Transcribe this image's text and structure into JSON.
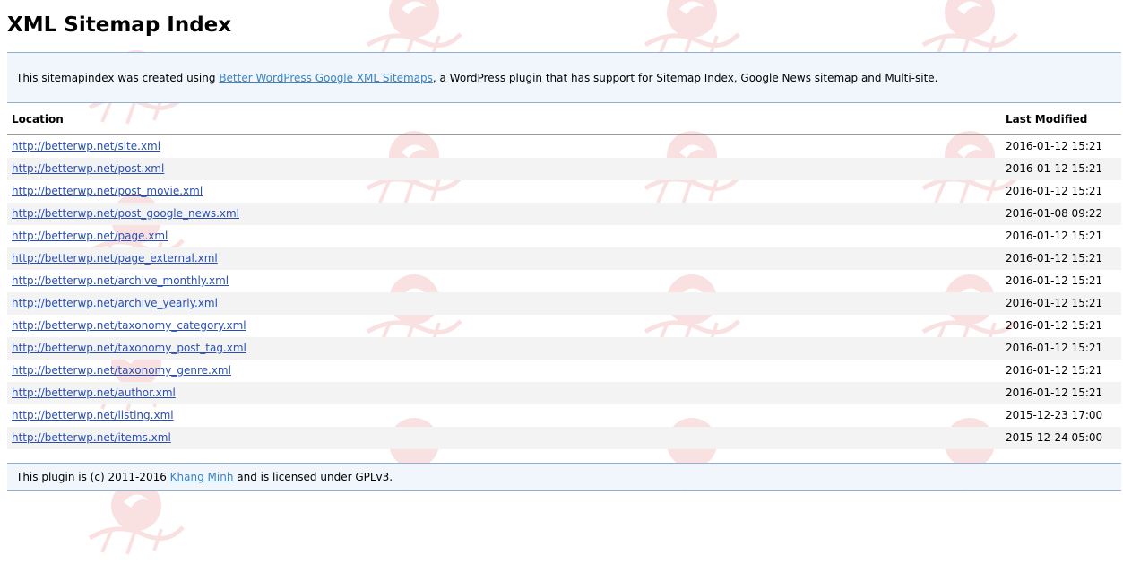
{
  "page": {
    "title": "XML Sitemap Index"
  },
  "intro": {
    "prefix": "This sitemapindex was created using ",
    "link_text": "Better WordPress Google XML Sitemaps",
    "suffix": ", a WordPress plugin that has support for Sitemap Index, Google News sitemap and Multi-site."
  },
  "table": {
    "headers": {
      "location": "Location",
      "last_modified": "Last Modified"
    },
    "rows": [
      {
        "location": "http://betterwp.net/site.xml",
        "last_modified": "2016-01-12 15:21"
      },
      {
        "location": "http://betterwp.net/post.xml",
        "last_modified": "2016-01-12 15:21"
      },
      {
        "location": "http://betterwp.net/post_movie.xml",
        "last_modified": "2016-01-12 15:21"
      },
      {
        "location": "http://betterwp.net/post_google_news.xml",
        "last_modified": "2016-01-08 09:22"
      },
      {
        "location": "http://betterwp.net/page.xml",
        "last_modified": "2016-01-12 15:21"
      },
      {
        "location": "http://betterwp.net/page_external.xml",
        "last_modified": "2016-01-12 15:21"
      },
      {
        "location": "http://betterwp.net/archive_monthly.xml",
        "last_modified": "2016-01-12 15:21"
      },
      {
        "location": "http://betterwp.net/archive_yearly.xml",
        "last_modified": "2016-01-12 15:21"
      },
      {
        "location": "http://betterwp.net/taxonomy_category.xml",
        "last_modified": "2016-01-12 15:21"
      },
      {
        "location": "http://betterwp.net/taxonomy_post_tag.xml",
        "last_modified": "2016-01-12 15:21"
      },
      {
        "location": "http://betterwp.net/taxonomy_genre.xml",
        "last_modified": "2016-01-12 15:21"
      },
      {
        "location": "http://betterwp.net/author.xml",
        "last_modified": "2016-01-12 15:21"
      },
      {
        "location": "http://betterwp.net/listing.xml",
        "last_modified": "2015-12-23 17:00"
      },
      {
        "location": "http://betterwp.net/items.xml",
        "last_modified": "2015-12-24 05:00"
      }
    ]
  },
  "footer": {
    "prefix": "This plugin is (c) 2011-2016 ",
    "link_text": "Khang Minh",
    "suffix": " and is licensed under GPLv3."
  },
  "watermark": {
    "icon": "watermark-logo-icon",
    "color": "#d8202a"
  }
}
